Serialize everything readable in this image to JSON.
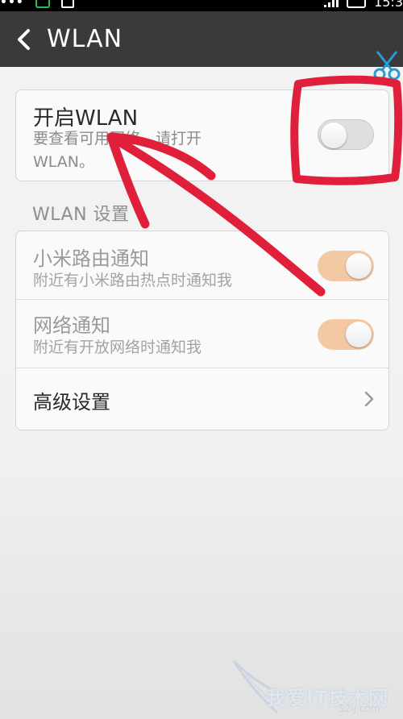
{
  "status_bar": {
    "time": "15:3",
    "icons": [
      "menu-dots-icon",
      "chat-icon",
      "gallery-icon",
      "signal-icon",
      "battery-icon"
    ]
  },
  "header": {
    "title": "WLAN",
    "back_icon": "chevron-left-icon"
  },
  "wlan_card": {
    "title": "开启WLAN",
    "subtitle_line1": "要查看可用网络，请打开",
    "subtitle_line2": "WLAN。",
    "toggle_state": "off"
  },
  "settings_section": {
    "label": "WLAN 设置",
    "items": [
      {
        "title": "小米路由通知",
        "subtitle": "附近有小米路由热点时通知我",
        "toggle_state": "on",
        "enabled": false
      },
      {
        "title": "网络通知",
        "subtitle": "附近有开放网络时通知我",
        "toggle_state": "on",
        "enabled": false
      },
      {
        "title": "高级设置",
        "icon": "chevron-right-icon"
      }
    ]
  },
  "annotation": {
    "color": "#e0203a",
    "shapes": [
      "highlight-box",
      "arrow"
    ]
  },
  "watermark": {
    "text": "我爱IT技术网",
    "url": "52ij.com"
  },
  "colors": {
    "titlebar": "#3a3a3a",
    "toggle_on": "#f3c9a4",
    "toggle_off": "#dfdfdf",
    "card_bg": "#fafafa"
  }
}
